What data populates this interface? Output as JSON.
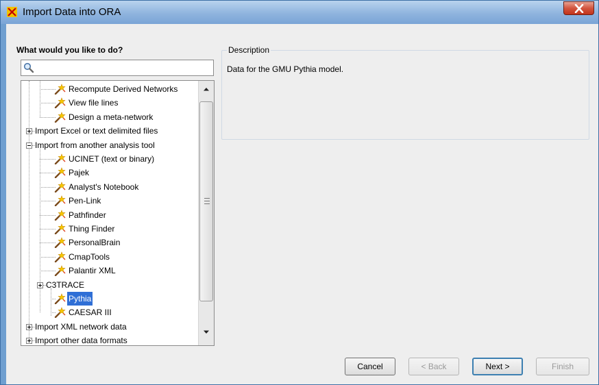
{
  "window": {
    "title": "Import Data into ORA",
    "close_label": "X"
  },
  "left_panel": {
    "label": "What would you like to do?",
    "search": {
      "value": "",
      "placeholder": ""
    }
  },
  "tree": {
    "items": [
      {
        "label": "Recompute Derived Networks",
        "icon": "wand-icon"
      },
      {
        "label": "View file lines",
        "icon": "wand-icon"
      },
      {
        "label": "Design a meta-network",
        "icon": "wand-icon"
      },
      {
        "label": "Import Excel or text delimited files",
        "expander": "plus"
      },
      {
        "label": "Import from another analysis tool",
        "expander": "minus"
      },
      {
        "label": "UCINET (text or binary)",
        "icon": "wand-icon"
      },
      {
        "label": "Pajek",
        "icon": "wand-icon"
      },
      {
        "label": "Analyst's Notebook",
        "icon": "wand-icon"
      },
      {
        "label": "Pen-Link",
        "icon": "wand-icon"
      },
      {
        "label": "Pathfinder",
        "icon": "wand-icon"
      },
      {
        "label": "Thing Finder",
        "icon": "wand-icon"
      },
      {
        "label": "PersonalBrain",
        "icon": "wand-icon"
      },
      {
        "label": "CmapTools",
        "icon": "wand-icon"
      },
      {
        "label": "Palantir XML",
        "icon": "wand-icon"
      },
      {
        "label": "C3TRACE",
        "expander": "plus"
      },
      {
        "label": "Pythia",
        "icon": "wand-icon",
        "selected": true
      },
      {
        "label": "CAESAR III",
        "icon": "wand-icon"
      },
      {
        "label": "Import XML network data",
        "expander": "plus"
      },
      {
        "label": "Import other data formats",
        "expander": "plus"
      }
    ]
  },
  "description": {
    "legend": "Description",
    "text": "Data for the GMU Pythia model."
  },
  "buttons": {
    "cancel": "Cancel",
    "back": "< Back",
    "next": "Next >",
    "finish": "Finish"
  },
  "colors": {
    "title_bar": "#8fb4de",
    "selection": "#2f6fd6",
    "close_button": "#c2331a"
  }
}
